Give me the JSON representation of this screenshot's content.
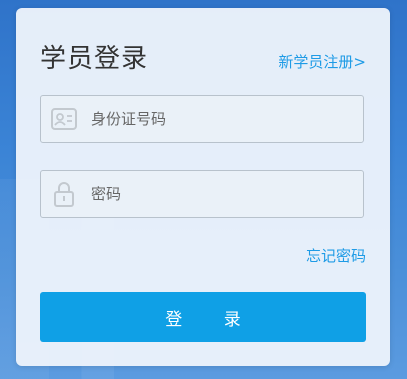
{
  "login": {
    "title": "学员登录",
    "register_link": "新学员注册>",
    "id_field": {
      "placeholder": "身份证号码",
      "value": "",
      "icon": "id-card-icon"
    },
    "password_field": {
      "placeholder": "密码",
      "value": "",
      "icon": "lock-icon"
    },
    "forgot_link": "忘记密码",
    "submit_label": "登 录"
  },
  "colors": {
    "accent": "#0fa0e6",
    "link": "#1e9be6",
    "background": "#3b84d6",
    "card": "#ecf3fb"
  }
}
